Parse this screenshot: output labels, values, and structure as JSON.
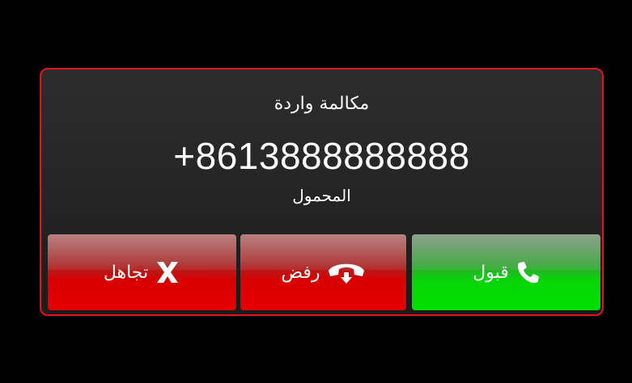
{
  "call": {
    "title": "مكالمة واردة",
    "number": "+8613888888888",
    "caller_type": "المحمول"
  },
  "buttons": {
    "ignore": {
      "label": "تجاهل",
      "icon": "x-icon",
      "color": "#e40000"
    },
    "reject": {
      "label": "رفض",
      "icon": "hang-up-phone-icon",
      "color": "#e40000"
    },
    "accept": {
      "label": "قبول",
      "icon": "phone-icon",
      "color": "#00e000"
    }
  },
  "colors": {
    "background": "#000000",
    "dialog_border": "#e3121c",
    "dialog_background": "#262626",
    "text": "#ffffff"
  }
}
